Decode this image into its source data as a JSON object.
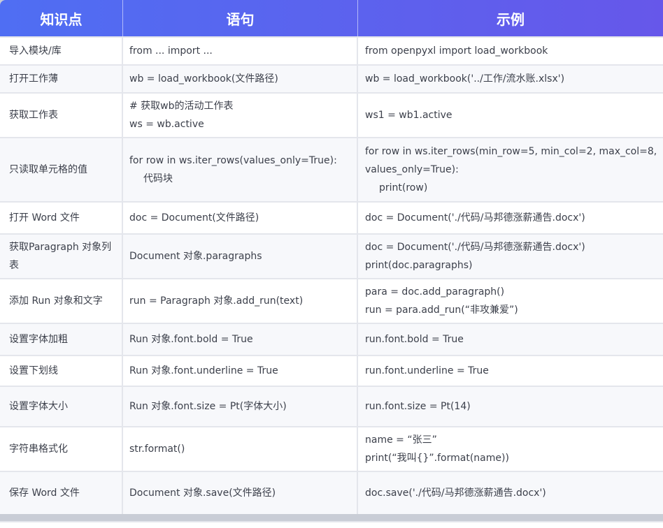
{
  "header": {
    "col1": "知识点",
    "col2": "语句",
    "col3": "示例"
  },
  "rows": [
    {
      "topic": "导入模块/库",
      "syntax": [
        "from ... import ..."
      ],
      "example": [
        "from openpyxl import load_workbook"
      ]
    },
    {
      "topic": "打开工作薄",
      "syntax": [
        "wb = load_workbook(文件路径)"
      ],
      "example": [
        "wb = load_workbook('../工作/流水账.xlsx')"
      ]
    },
    {
      "topic": "获取工作表",
      "syntax": [
        "# 获取wb的活动工作表",
        "ws = wb.active"
      ],
      "example": [
        "ws1 = wb1.active"
      ]
    },
    {
      "topic": "只读取单元格的值",
      "syntax": [
        "for row in ws.iter_rows(values_only=True):",
        "代码块"
      ],
      "example": [
        "for row in ws.iter_rows(min_row=5, min_col=2, max_col=8,",
        "values_only=True):",
        "print(row)"
      ]
    },
    {
      "topic": "打开 Word 文件",
      "syntax": [
        "doc = Document(文件路径)"
      ],
      "example": [
        "doc = Document('./代码/马邦德涨薪通告.docx')"
      ]
    },
    {
      "topic": "获取Paragraph 对象列表",
      "syntax": [
        "Document 对象.paragraphs"
      ],
      "example": [
        "doc = Document('./代码/马邦德涨薪通告.docx')",
        "print(doc.paragraphs)"
      ]
    },
    {
      "topic": "添加 Run 对象和文字",
      "syntax": [
        "run = Paragraph 对象.add_run(text)"
      ],
      "example": [
        "para = doc.add_paragraph()",
        "run = para.add_run(“非攻兼爱”)"
      ]
    },
    {
      "topic": "设置字体加粗",
      "syntax": [
        "Run 对象.font.bold = True"
      ],
      "example": [
        "run.font.bold = True"
      ]
    },
    {
      "topic": "设置下划线",
      "syntax": [
        "Run 对象.font.underline = True"
      ],
      "example": [
        "run.font.underline = True"
      ]
    },
    {
      "topic": "设置字体大小",
      "syntax": [
        "Run 对象.font.size = Pt(字体大小)"
      ],
      "example": [
        "run.font.size = Pt(14)"
      ]
    },
    {
      "topic": "字符串格式化",
      "syntax": [
        "str.format()"
      ],
      "example": [
        "name = “张三”",
        "print(“我叫{}”.format(name))"
      ]
    },
    {
      "topic": "保存 Word 文件",
      "syntax": [
        "Document 对象.save(文件路径)"
      ],
      "example": [
        "doc.save('./代码/马邦德涨薪通告.docx')"
      ]
    }
  ]
}
